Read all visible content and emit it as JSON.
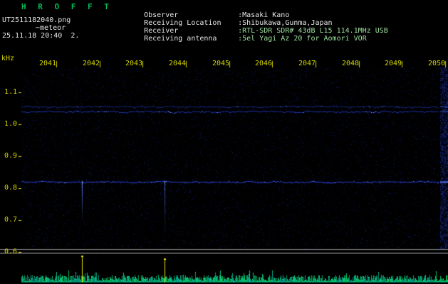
{
  "header": {
    "title": "H R O F F T",
    "filename": "UT2511182040.png",
    "note": "~meteor",
    "datetime": "25.11.18 20:40  2.",
    "info": [
      {
        "label": "Observer",
        "value": ":Masaki Kano"
      },
      {
        "label": "Receiving Location",
        "value": ":Shibukawa,Gunma,Japan"
      },
      {
        "label": "Receiver",
        "value": ":RTL-SDR SDR# 43dB L15 114.1MHz USB"
      },
      {
        "label": "Receiving antenna",
        "value": ":5el Yagi Az 20 for Aomori VOR"
      }
    ]
  },
  "chart_data": {
    "type": "heatmap",
    "description": "Radio meteor observation spectrogram: frequency (kHz) vs UT time over 10 minutes, with signal-level strip below",
    "x": {
      "unit": "UT time (hhmm)",
      "ticks": [
        2041,
        2042,
        2043,
        2044,
        2045,
        2046,
        2047,
        2048,
        2049,
        2050
      ],
      "range": [
        2040.2,
        2049.9
      ]
    },
    "y": {
      "label": "kHz",
      "ticks": [
        1.1,
        1.0,
        0.9,
        0.8,
        0.7,
        0.6
      ],
      "range": [
        0.61,
        1.18
      ]
    },
    "carriers": [
      {
        "freq_khz": 1.055,
        "strength": 0.3
      },
      {
        "freq_khz": 1.04,
        "strength": 0.55
      },
      {
        "freq_khz": 0.82,
        "strength": 1.0
      }
    ],
    "meteor_echoes": [
      {
        "time": 2041.6,
        "freq_top_khz": 0.82,
        "freq_bottom_khz": 0.7,
        "level": 1.0
      },
      {
        "time": 2043.5,
        "freq_top_khz": 0.82,
        "freq_bottom_khz": 0.67,
        "level": 0.8
      }
    ],
    "colors": {
      "background": "#000000",
      "axis_text": "#d4d400",
      "header_text": "#e4e4e4",
      "title_text": "#00c055",
      "value_green": "#9fe09f",
      "carrier_blue": "#2d4bff",
      "echo_blue": "#5a82ff",
      "level_trace": "#00c87d",
      "echo_marker": "#e6e600",
      "separator_gray": "#b8b8b8"
    }
  }
}
